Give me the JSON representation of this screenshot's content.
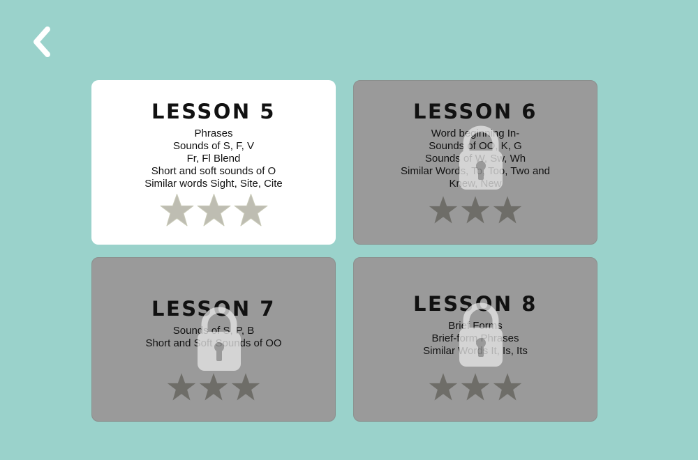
{
  "colors": {
    "background": "#9ad2cb",
    "card_unlocked": "#ffffff",
    "card_locked": "#9a9a9a",
    "star_unlocked": "#bebdb2",
    "star_locked": "#6e6d68",
    "lock": "#e8e8e8",
    "back_arrow": "#ffffff"
  },
  "nav": {
    "back_icon": "chevron-left-icon"
  },
  "lessons": [
    {
      "title": "LESSON 5",
      "locked": false,
      "lines": [
        "Phrases",
        "Sounds of S, F, V",
        "Fr, Fl Blend",
        "Short and soft sounds of O",
        "Similar words Sight, Site, Cite"
      ],
      "stars": 3
    },
    {
      "title": "LESSON 6",
      "locked": true,
      "lines": [
        "Word beginning In-",
        "Sounds of OO, K, G",
        "Sounds of W, Sw, Wh",
        "Similar Words, To, Too, Two and",
        "Knew, New"
      ],
      "stars": 3
    },
    {
      "title": "LESSON 7",
      "locked": true,
      "lines": [
        "Sounds of S, P, B",
        "Short and Soft Sounds of OO"
      ],
      "stars": 3
    },
    {
      "title": "LESSON 8",
      "locked": true,
      "lines": [
        "Brief Forms",
        "Brief-form Phrases",
        "Similar Words It, Is, Its"
      ],
      "stars": 3
    }
  ]
}
